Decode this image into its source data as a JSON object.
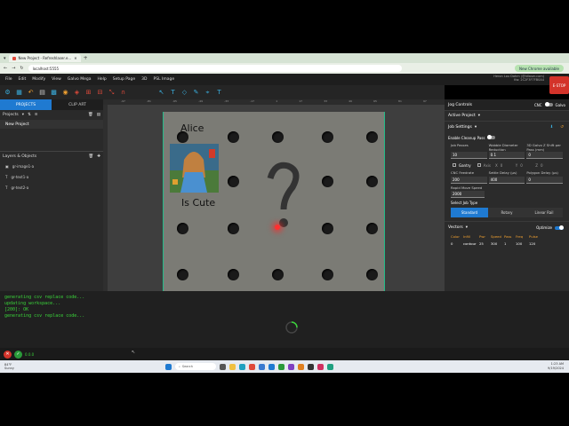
{
  "browser": {
    "tab_title": "New Project - Refreshlaser.e...",
    "url": "localhost:5555",
    "update_badge": "New Chrome available"
  },
  "menu": {
    "items": [
      "File",
      "Edit",
      "Modify",
      "View",
      "Galvo Mega",
      "Help",
      "Setup Page",
      "3D",
      "PSL Image"
    ],
    "user_line1": "Heron Lou Dahm (@ldlaser.com)",
    "user_line2": "Kw: 2C2F3F7FB0A4"
  },
  "estop": "E-STOP",
  "left_panel": {
    "tabs": [
      "PROJECTS",
      "CLIP ART"
    ],
    "projects_label": "Projects",
    "project_items": [
      "New Project"
    ],
    "layers_label": "Layers & Objects",
    "layers": [
      "gr-image1-a",
      "gr-text1-a",
      "gr-text2-a"
    ]
  },
  "ruler_ticks": [
    "-97",
    "-81",
    "-65",
    "-49",
    "-33",
    "-17",
    "1",
    "17",
    "33",
    "49",
    "65",
    "81",
    "97"
  ],
  "canvas": {
    "text1": "Alice",
    "text2": "Is Cute"
  },
  "right_panel": {
    "jog_controls": "Jog Controls",
    "mode_cnc": "CNC",
    "mode_galvo": "Galvo",
    "active_project": "Active Project",
    "job_settings": "Job Settings",
    "enable_cleanup": "Enable Cleanup Pass",
    "f_job_passes": "Job Passes",
    "v_job_passes": "10",
    "f_wobble": "Wobble Diameter Reduction",
    "v_wobble": "0.1",
    "f_3dgalvo": "3D Galvo Z Shift per Pass (mm)",
    "v_3dgalvo": "0",
    "gantry": "Gantry",
    "axis": "Axis",
    "x_label": "X",
    "x_val": "0",
    "y_label": "Y",
    "y_val": "0",
    "z_label": "Z",
    "z_val": "0",
    "f_cnc_feed": "CNC Feedrate",
    "v_cnc_feed": "200",
    "f_settle": "Settle Delay (µs)",
    "v_settle": "400",
    "f_polygon": "Polygon Delay (µs)",
    "v_polygon": "0",
    "f_rapid": "Rapid Move Speed",
    "v_rapid": "2000",
    "select_job_type": "Select Job Type",
    "job_types": [
      "Standard",
      "Rotary",
      "Linear Rail"
    ],
    "vectors": "Vectors",
    "optimize": "Optimize",
    "table_headers": [
      "Color",
      "Infill",
      "Pwr",
      "Speed",
      "Pass",
      "Freq",
      "Pulse"
    ],
    "table_row": [
      "0",
      "contour",
      "25",
      "300",
      "1",
      "100",
      "120"
    ]
  },
  "console": {
    "lines": [
      "generating csv replace code...",
      "updating workspace...",
      "[200]: OK",
      "generating csv replace code..."
    ]
  },
  "status": {
    "text": "0.0.0"
  },
  "taskbar": {
    "weather": "84°F",
    "weather2": "Sunny",
    "search": "Search",
    "time": "1:23 AM",
    "date": "9/19/2024"
  },
  "colors": {
    "accent": "#1f7ad1",
    "estop": "#d3332a",
    "console_text": "#3ad33a",
    "frame": "#22bb88",
    "orange": "#f0a030"
  }
}
